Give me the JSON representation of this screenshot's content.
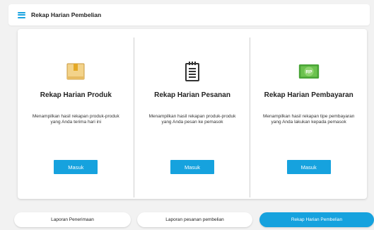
{
  "header": {
    "title": "Rekap Harian Pembelian",
    "menu_icon": "hamburger-menu-icon"
  },
  "cards": [
    {
      "icon": "box-icon",
      "title": "Rekap Harian Produk",
      "description": "Menampilkan hasil rekapan produk-produk yang Anda terima hari ini",
      "button": "Masuk"
    },
    {
      "icon": "notepad-icon",
      "title": "Rekap Harian Pesanan",
      "description": "Menampilkan hasil rekapan produk-produk yang Anda pesan ke pemasok",
      "button": "Masuk"
    },
    {
      "icon": "rupiah-money-icon",
      "icon_text": "RP",
      "title": "Rekap Harian Pembayaran",
      "description": "Menampilkan hasil rekapan tipe pembayaran yang Anda lakukan kepada pemasok",
      "button": "Masuk"
    }
  ],
  "tabs": [
    {
      "label": "Laporan Penerimaan",
      "active": false
    },
    {
      "label": "Laporan pesanan pembelian",
      "active": false
    },
    {
      "label": "Rekap Harian Pembelian",
      "active": true
    }
  ],
  "colors": {
    "accent": "#16a2de",
    "box": "#f0c56a",
    "money": "#5cb646"
  }
}
